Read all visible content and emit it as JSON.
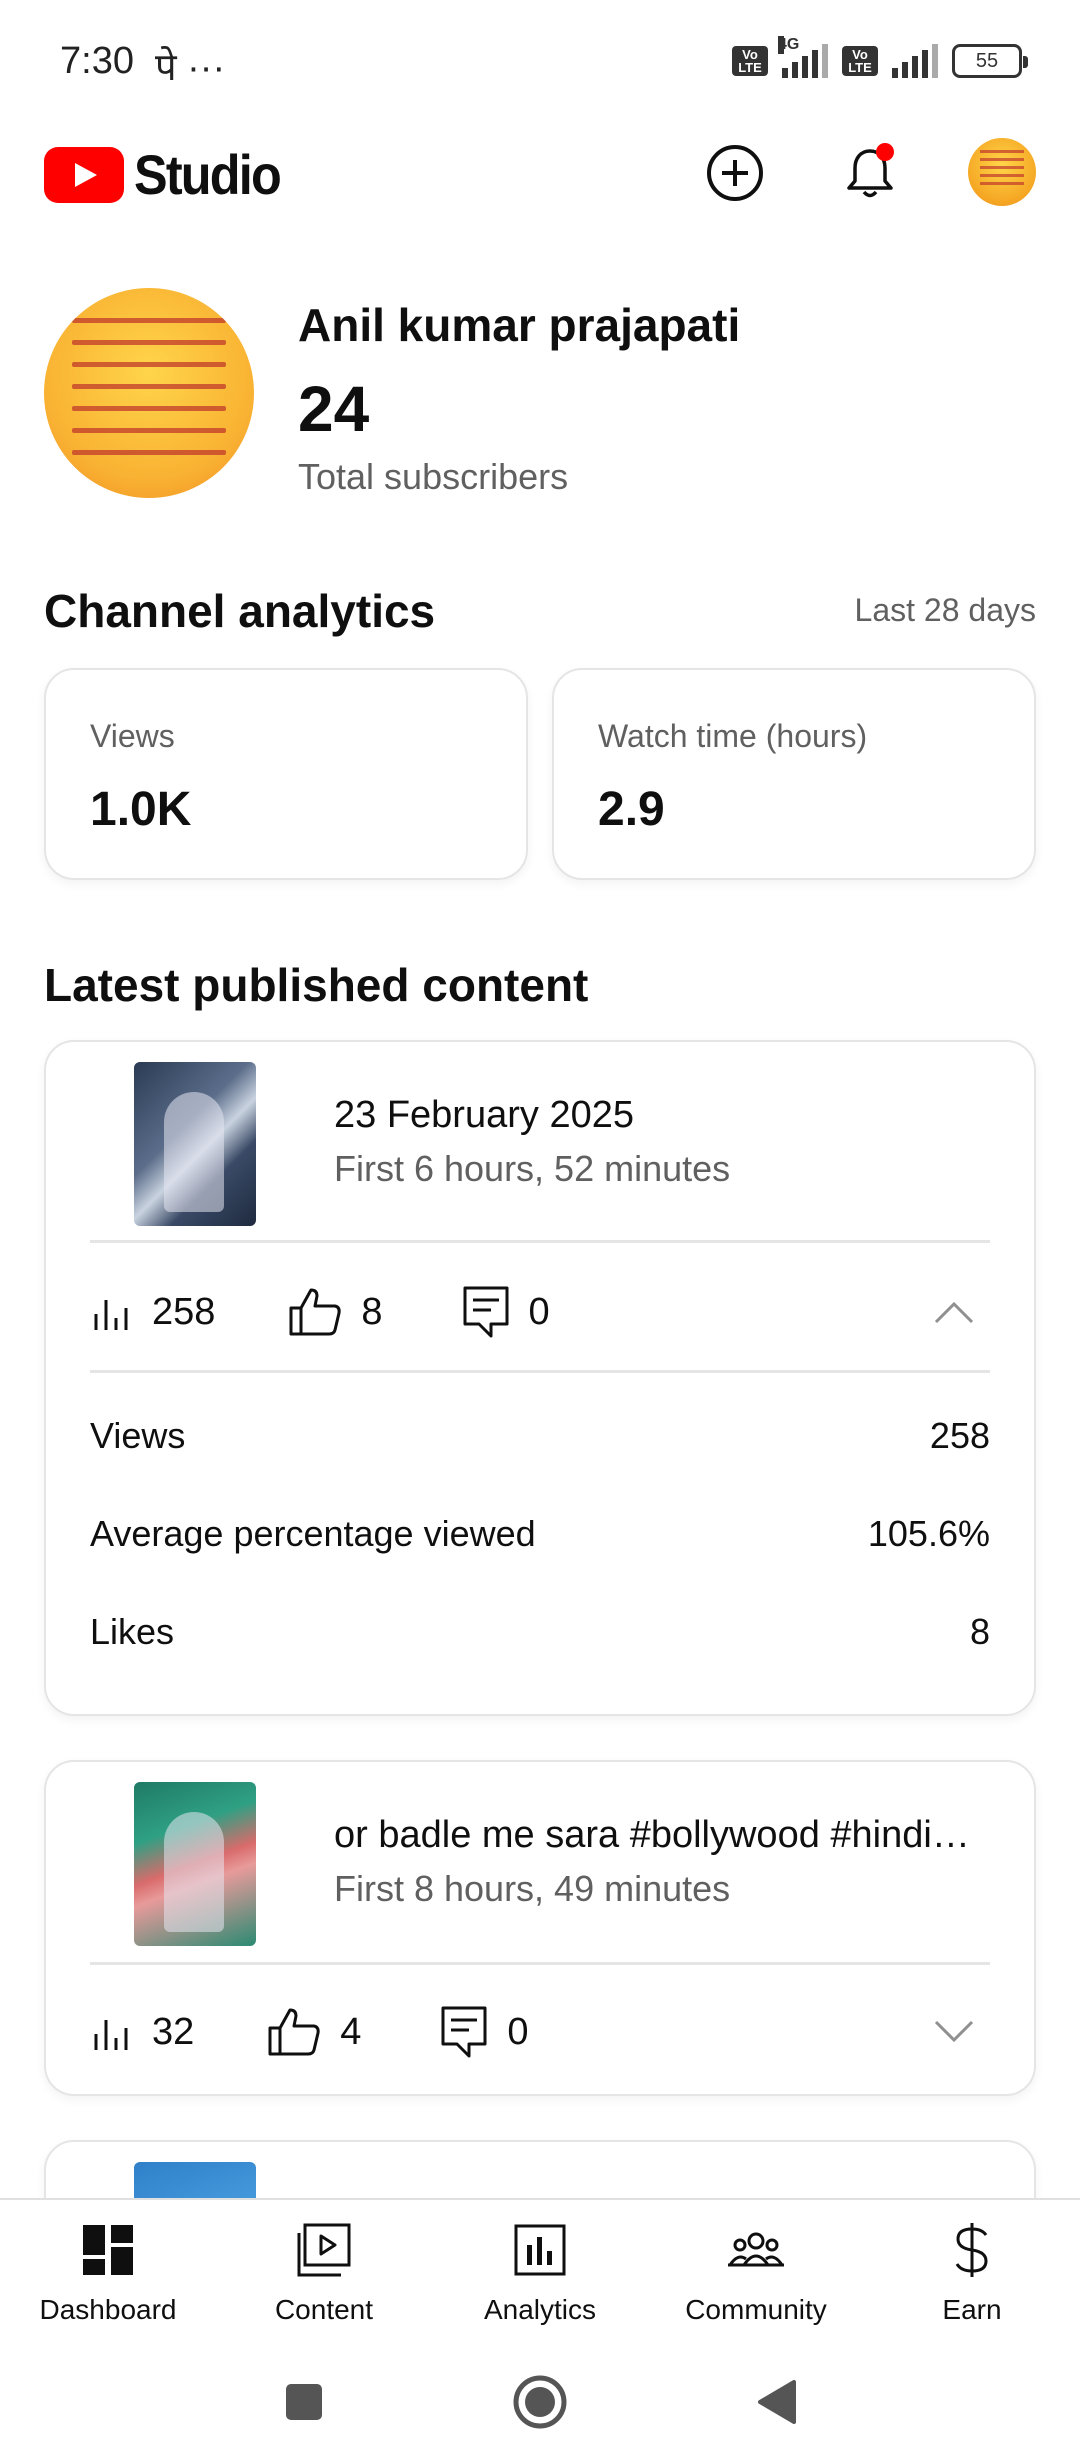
{
  "status_bar": {
    "time": "7:30",
    "extra": "पे ···",
    "network": "4G",
    "battery": "55"
  },
  "header": {
    "app_name": "Studio",
    "brand_color": "#ff0000",
    "notification_dot_color": "#ff0000"
  },
  "channel": {
    "name": "Anil kumar prajapati",
    "subscribers": "24",
    "subscribers_label": "Total subscribers"
  },
  "analytics": {
    "title": "Channel analytics",
    "range": "Last 28 days",
    "cards": [
      {
        "label": "Views",
        "value": "1.0K"
      },
      {
        "label": "Watch time (hours)",
        "value": "2.9"
      }
    ]
  },
  "latest": {
    "title": "Latest published content",
    "items": [
      {
        "title": "23 February 2025",
        "subtitle": "First 6 hours, 52 minutes",
        "views": "258",
        "likes": "8",
        "comments": "0",
        "expanded": true,
        "details": [
          {
            "label": "Views",
            "value": "258"
          },
          {
            "label": "Average percentage viewed",
            "value": "105.6%"
          },
          {
            "label": "Likes",
            "value": "8"
          }
        ]
      },
      {
        "title": "or badle me sara #bollywood #hindi…",
        "subtitle": "First 8 hours, 49 minutes",
        "views": "32",
        "likes": "4",
        "comments": "0",
        "expanded": false
      }
    ]
  },
  "bottom_nav": [
    {
      "label": "Dashboard",
      "icon": "dashboard-icon"
    },
    {
      "label": "Content",
      "icon": "content-icon"
    },
    {
      "label": "Analytics",
      "icon": "analytics-icon"
    },
    {
      "label": "Community",
      "icon": "community-icon"
    },
    {
      "label": "Earn",
      "icon": "dollar-icon"
    }
  ]
}
